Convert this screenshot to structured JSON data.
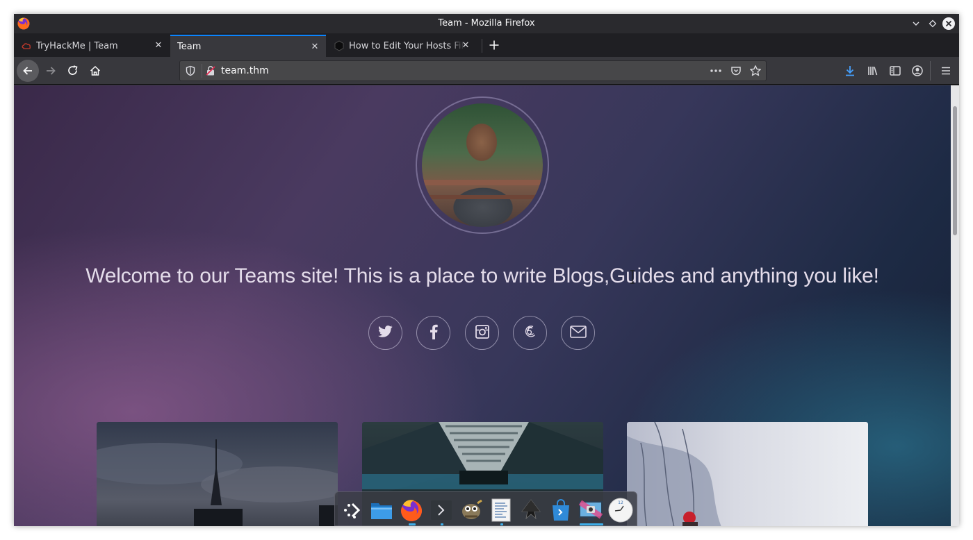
{
  "window": {
    "title": "Team - Mozilla Firefox"
  },
  "tabs": [
    {
      "label": "TryHackMe | Team",
      "selected": false
    },
    {
      "label": "Team",
      "selected": true
    },
    {
      "label": "How to Edit Your Hosts File",
      "selected": false
    }
  ],
  "urlbar": {
    "url": "team.thm"
  },
  "page": {
    "welcome": "Welcome to our Teams site! This is a place to write Blogs,Guides and anything you like!",
    "social": [
      "twitter-icon",
      "facebook-icon",
      "instagram-icon",
      "500px-icon",
      "envelope-icon"
    ]
  },
  "dock": {
    "items": [
      "app-launcher-icon",
      "file-manager-icon",
      "firefox-icon",
      "terminal-icon",
      "gimp-icon",
      "text-editor-icon",
      "inkscape-icon",
      "software-store-icon",
      "screenshot-icon",
      "clock-icon"
    ],
    "clock_label": "12"
  },
  "colors": {
    "accent": "#0a84ff",
    "dock_indicator": "#3daee9"
  }
}
